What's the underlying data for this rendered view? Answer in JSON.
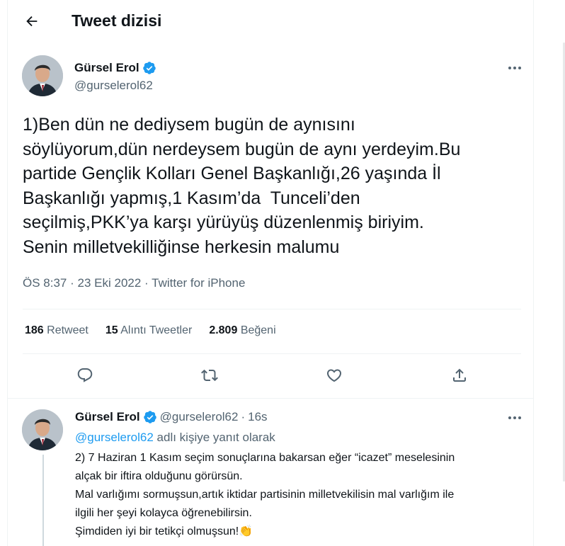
{
  "header": {
    "title": "Tweet dizisi"
  },
  "main_tweet": {
    "author_name": "Gürsel Erol",
    "author_handle": "@gurselerol62",
    "text": "1)Ben dün ne dediysem bugün de aynısını\nsöylüyorum,dün nerdeysem bugün de aynı yerdeyim.Bu\npartide Gençlik Kolları Genel Başkanlığı,26 yaşında İl\nBaşkanlığı yapmış,1 Kasım’da  Tunceli’den\nseçilmiş,PKK’ya karşı yürüyüş düzenlenmiş biriyim.\nSenin milletvekilliğinse herkesin malumu",
    "time": "ÖS 8:37",
    "date": "23 Eki 2022",
    "source": "Twitter for iPhone",
    "sep": "·",
    "stats": {
      "retweets_count": "186",
      "retweets_label": "Retweet",
      "quotes_count": "15",
      "quotes_label": "Alıntı Tweetler",
      "likes_count": "2.809",
      "likes_label": "Beğeni"
    }
  },
  "reply": {
    "author_name": "Gürsel Erol",
    "author_handle": "@gurselerol62",
    "sep": "·",
    "time_ago": "16s",
    "reply_to_handle": "@gurselerol62",
    "reply_to_suffix": " adlı kişiye yanıt olarak",
    "text": "2) 7 Haziran 1 Kasım seçim sonuçlarına bakarsan eğer “icazet” meselesinin\nalçak bir iftira olduğunu görürsün.\nMal varlığımı sormuşsun,artık iktidar partisinin milletvekilisin mal varlığım ile\nilgili her şeyi kolayca öğrenebilirsin.\nŞimdiden iyi bir tetikçi olmuşsun!👏"
  },
  "colors": {
    "accent": "#1d9bf0",
    "muted": "#536471",
    "text": "#0f1419"
  },
  "icons": [
    "back-arrow-icon",
    "verified-badge-icon",
    "more-options-icon",
    "reply-icon",
    "retweet-icon",
    "like-icon",
    "share-icon"
  ]
}
